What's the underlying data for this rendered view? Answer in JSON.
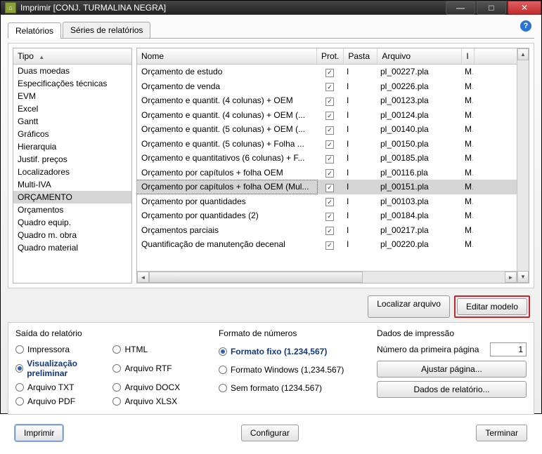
{
  "window": {
    "title": "Imprimir [CONJ. TURMALINA NEGRA]"
  },
  "tabs": {
    "relatorios": "Relatórios",
    "series": "Séries de relatórios"
  },
  "tipo": {
    "header": "Tipo",
    "items": [
      "Duas moedas",
      "Especificações técnicas",
      "EVM",
      "Excel",
      "Gantt",
      "Gráficos",
      "Hierarquia",
      "Justif. preços",
      "Localizadores",
      "Multi-IVA",
      "ORÇAMENTO",
      "Orçamentos",
      "Quadro equip.",
      "Quadro m. obra",
      "Quadro material"
    ],
    "selected_index": 10
  },
  "reports": {
    "headers": {
      "nome": "Nome",
      "prot": "Prot.",
      "pasta": "Pasta",
      "arquivo": "Arquivo",
      "l": "I"
    },
    "rows": [
      {
        "nome": "Orçamento de estudo",
        "prot": true,
        "pasta": "I",
        "arquivo": "pl_00227.pla",
        "l": "M"
      },
      {
        "nome": "Orçamento de venda",
        "prot": true,
        "pasta": "I",
        "arquivo": "pl_00226.pla",
        "l": "M"
      },
      {
        "nome": "Orçamento e quantit. (4 colunas) + OEM",
        "prot": true,
        "pasta": "I",
        "arquivo": "pl_00123.pla",
        "l": "M"
      },
      {
        "nome": "Orçamento e quantit. (4 colunas) + OEM (...",
        "prot": true,
        "pasta": "I",
        "arquivo": "pl_00124.pla",
        "l": "M"
      },
      {
        "nome": "Orçamento e quantit. (5 colunas) + OEM (...",
        "prot": true,
        "pasta": "I",
        "arquivo": "pl_00140.pla",
        "l": "M"
      },
      {
        "nome": "Orçamento e quantit. (5 colunas) + Folha ...",
        "prot": true,
        "pasta": "I",
        "arquivo": "pl_00150.pla",
        "l": "M"
      },
      {
        "nome": "Orçamento e quantitativos (6 colunas) + F...",
        "prot": true,
        "pasta": "I",
        "arquivo": "pl_00185.pla",
        "l": "M"
      },
      {
        "nome": "Orçamento por capítulos + folha OEM",
        "prot": true,
        "pasta": "I",
        "arquivo": "pl_00116.pla",
        "l": "M"
      },
      {
        "nome": "Orçamento por capítulos + folha OEM (Mul...",
        "prot": true,
        "pasta": "I",
        "arquivo": "pl_00151.pla",
        "l": "M"
      },
      {
        "nome": "Orçamento por quantidades",
        "prot": true,
        "pasta": "I",
        "arquivo": "pl_00103.pla",
        "l": "M"
      },
      {
        "nome": "Orçamento por quantidades (2)",
        "prot": true,
        "pasta": "I",
        "arquivo": "pl_00184.pla",
        "l": "M"
      },
      {
        "nome": "Orçamentos parciais",
        "prot": true,
        "pasta": "I",
        "arquivo": "pl_00217.pla",
        "l": "M"
      },
      {
        "nome": "Quantificação de manutenção decenal",
        "prot": true,
        "pasta": "I",
        "arquivo": "pl_00220.pla",
        "l": "M"
      }
    ],
    "selected_index": 8
  },
  "buttons": {
    "localizar": "Localizar arquivo",
    "editar": "Editar modelo",
    "imprimir": "Imprimir",
    "configurar": "Configurar",
    "terminar": "Terminar",
    "ajustar": "Ajustar página...",
    "dados_rel": "Dados de relatório..."
  },
  "saida": {
    "title": "Saída do relatório",
    "opts": {
      "impressora": "Impressora",
      "visual": "Visualização preliminar",
      "txt": "Arquivo TXT",
      "pdf": "Arquivo PDF",
      "html": "HTML",
      "rtf": "Arquivo RTF",
      "docx": "Arquivo DOCX",
      "xlsx": "Arquivo XLSX"
    },
    "selected": "visual"
  },
  "formato": {
    "title": "Formato de números",
    "opts": {
      "fixo": "Formato fixo (1.234,567)",
      "win": "Formato Windows (1,234.567)",
      "sem": "Sem formato (1234.567)"
    },
    "selected": "fixo"
  },
  "dados_imp": {
    "title": "Dados de impressão",
    "primeira_label": "Número da primeira página",
    "primeira_value": "1"
  }
}
